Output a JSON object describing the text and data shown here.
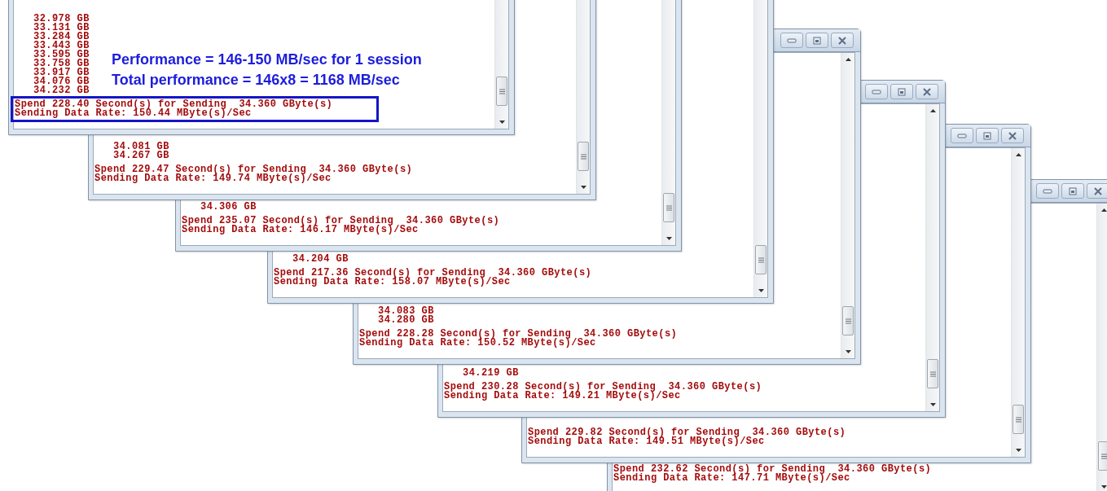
{
  "windows": [
    {
      "lines": [
        "32.978 GB",
        "33.131 GB",
        "33.284 GB",
        "33.443 GB",
        "33.595 GB",
        "33.758 GB",
        "33.917 GB",
        "34.076 GB",
        "34.232 GB"
      ],
      "summary": [
        "Spend 228.40 Second(s) for Sending  34.360 GByte(s)",
        "Sending Data Rate: 150.44 MByte(s)/Sec"
      ],
      "highlighted": true
    },
    {
      "lines": [
        "34.081 GB",
        "34.267 GB"
      ],
      "summary": [
        "Spend 229.47 Second(s) for Sending  34.360 GByte(s)",
        "Sending Data Rate: 149.74 MByte(s)/Sec"
      ],
      "highlighted": false
    },
    {
      "lines": [
        "34.306 GB"
      ],
      "summary": [
        "Spend 235.07 Second(s) for Sending  34.360 GByte(s)",
        "Sending Data Rate: 146.17 MByte(s)/Sec"
      ],
      "highlighted": false
    },
    {
      "lines": [
        "34.204 GB"
      ],
      "summary": [
        "Spend 217.36 Second(s) for Sending  34.360 GByte(s)",
        "Sending Data Rate: 158.07 MByte(s)/Sec"
      ],
      "highlighted": false
    },
    {
      "lines": [
        "34.083 GB",
        "34.280 GB"
      ],
      "summary": [
        "Spend 228.28 Second(s) for Sending  34.360 GByte(s)",
        "Sending Data Rate: 150.52 MByte(s)/Sec"
      ],
      "highlighted": false
    },
    {
      "lines": [
        "34.219 GB"
      ],
      "summary": [
        "Spend 230.28 Second(s) for Sending  34.360 GByte(s)",
        "Sending Data Rate: 149.21 MByte(s)/Sec"
      ],
      "highlighted": false
    },
    {
      "summary": [
        "Spend 229.82 Second(s) for Sending  34.360 GByte(s)",
        "Sending Data Rate: 149.51 MByte(s)/Sec"
      ],
      "highlighted": false
    },
    {
      "summary": [
        "Spend 232.62 Second(s) for Sending  34.360 GByte(s)",
        "Sending Data Rate: 147.71 MByte(s)/Sec"
      ],
      "highlighted": false
    }
  ],
  "annotation": [
    "Performance = 146-150 MB/sec for 1 session",
    "Total performance = 146x8 = 1168 MB/sec"
  ]
}
